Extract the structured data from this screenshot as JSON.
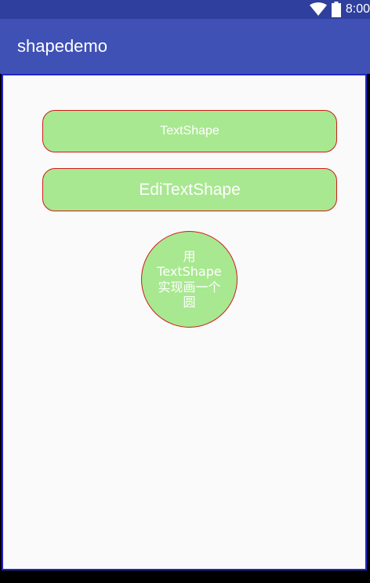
{
  "status_bar": {
    "time": "8:00",
    "icons": [
      "wifi-icon",
      "battery-icon"
    ]
  },
  "app_bar": {
    "title": "shapedemo"
  },
  "main": {
    "text_shape_label": "TextShape",
    "edit_text_shape_value": "EdiTextShape",
    "circle_lines": [
      "用",
      "TextShape",
      "实现画一个",
      "圆"
    ]
  },
  "colors": {
    "status_bar": "#2f3f9e",
    "app_bar": "#3f51b5",
    "shape_fill": "#a8e890",
    "shape_stroke": "#d11a1a",
    "background": "#fafafa"
  }
}
